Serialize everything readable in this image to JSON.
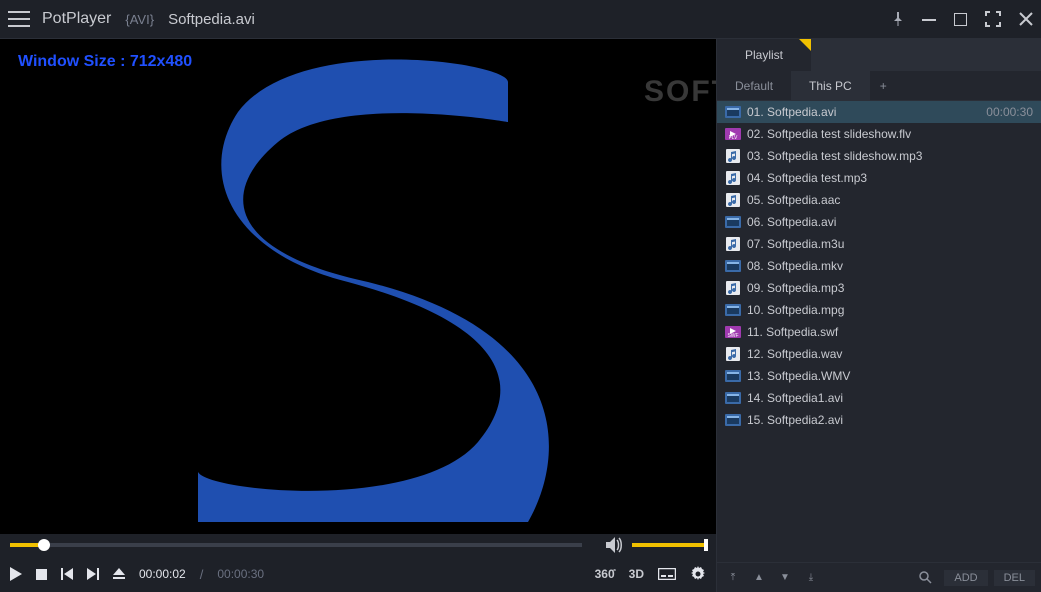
{
  "titlebar": {
    "app_name": "PotPlayer",
    "format_tag": "{AVI}",
    "file_name": "Softpedia.avi"
  },
  "video": {
    "overlay": "Window Size : 712x480",
    "watermark": "SOFTPEDIA"
  },
  "playback": {
    "current": "00:00:02",
    "sep": "/",
    "duration": "00:00:30",
    "progress_pct": 6
  },
  "ctrl_right": {
    "r360": "360̊",
    "r3d": "3D"
  },
  "sidebar": {
    "tab_playlist": "Playlist",
    "subtabs": {
      "default": "Default",
      "thispc": "This PC",
      "plus": "+"
    },
    "items": [
      {
        "icon": "video",
        "label": "01. Softpedia.avi",
        "duration": "00:00:30",
        "selected": true
      },
      {
        "icon": "flv",
        "label": "02. Softpedia test slideshow.flv"
      },
      {
        "icon": "audio",
        "label": "03. Softpedia test slideshow.mp3"
      },
      {
        "icon": "audio",
        "label": "04. Softpedia test.mp3"
      },
      {
        "icon": "audio",
        "label": "05. Softpedia.aac"
      },
      {
        "icon": "video",
        "label": "06. Softpedia.avi"
      },
      {
        "icon": "audio",
        "label": "07. Softpedia.m3u"
      },
      {
        "icon": "video",
        "label": "08. Softpedia.mkv"
      },
      {
        "icon": "audio",
        "label": "09. Softpedia.mp3"
      },
      {
        "icon": "video",
        "label": "10. Softpedia.mpg"
      },
      {
        "icon": "swf",
        "label": "11. Softpedia.swf"
      },
      {
        "icon": "audio",
        "label": "12. Softpedia.wav"
      },
      {
        "icon": "video",
        "label": "13. Softpedia.WMV"
      },
      {
        "icon": "video",
        "label": "14. Softpedia1.avi"
      },
      {
        "icon": "video",
        "label": "15. Softpedia2.avi"
      }
    ],
    "footer": {
      "add": "ADD",
      "del": "DEL"
    }
  }
}
